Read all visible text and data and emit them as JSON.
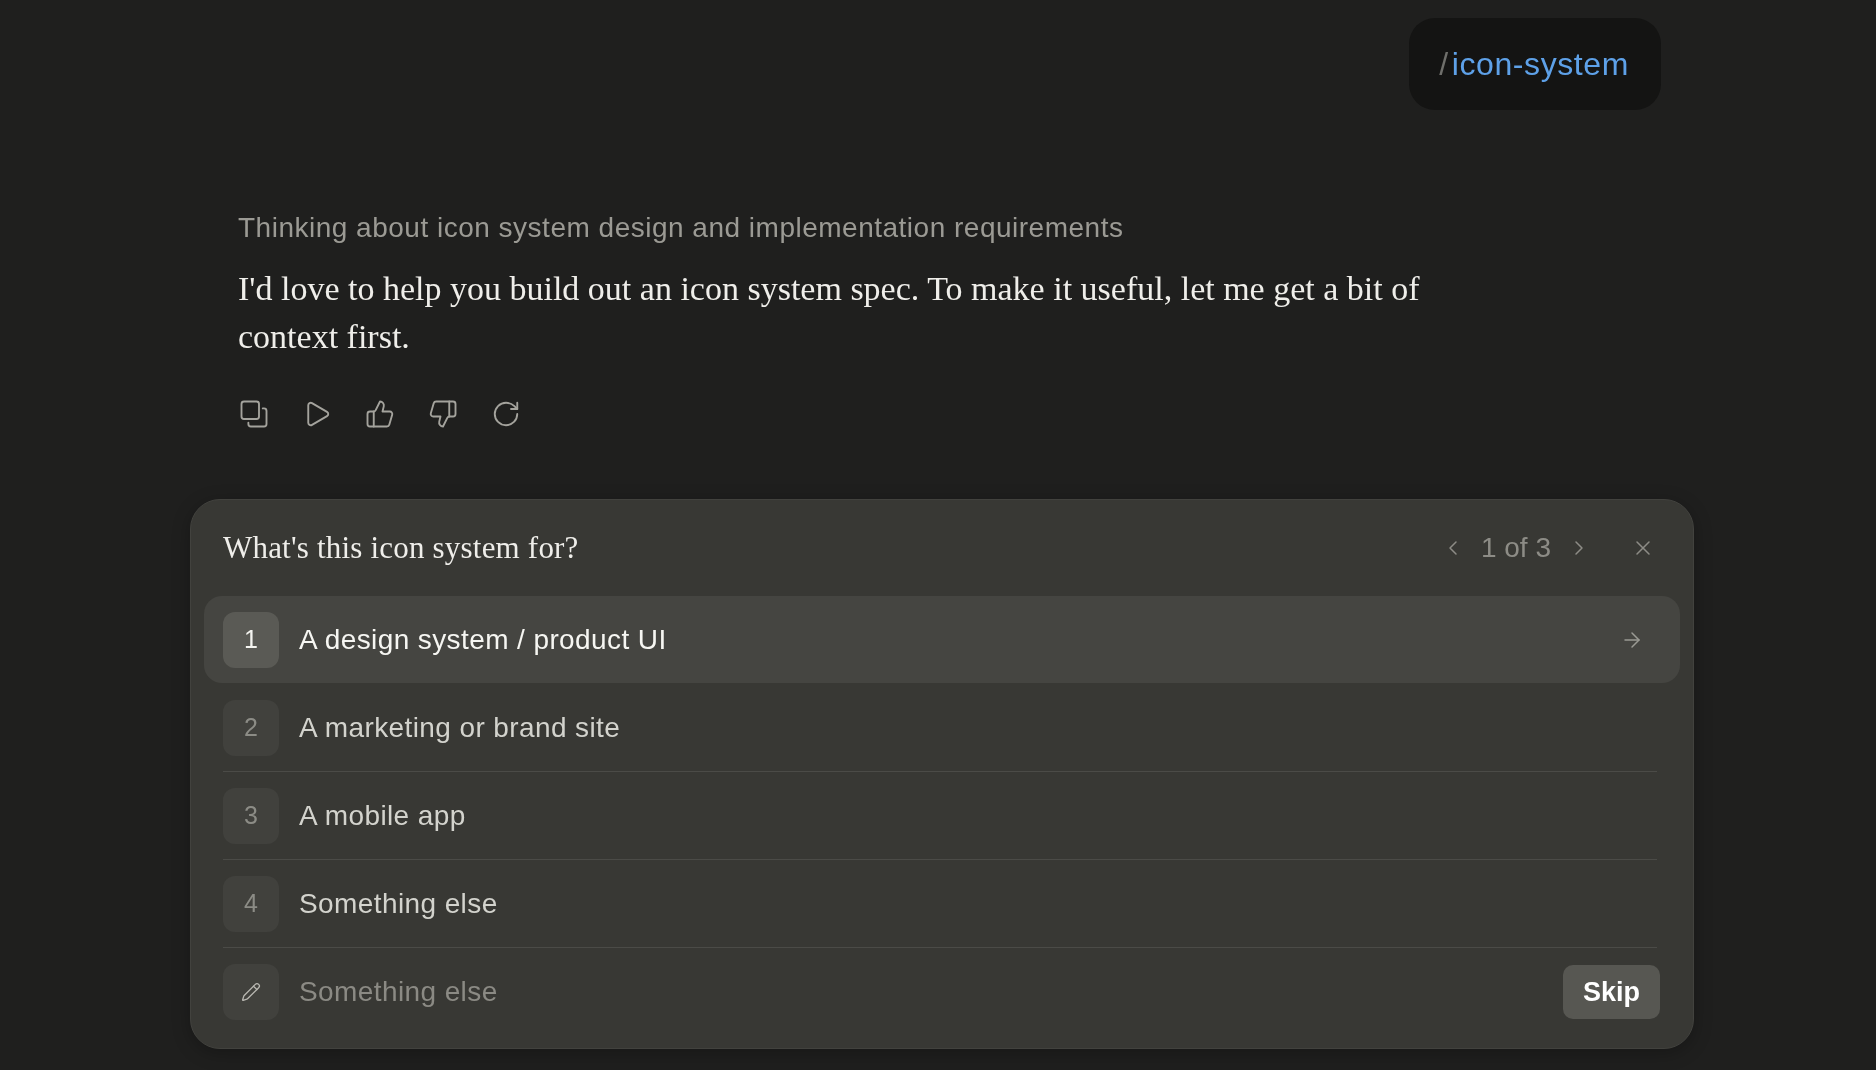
{
  "command_badge": {
    "prefix": "/",
    "command": "icon-system"
  },
  "thinking_summary": "Thinking about icon system design and implementation requirements",
  "message": "I'd love to help you build out an icon system spec. To make it useful, let me get a bit of context first.",
  "question_panel": {
    "question": "What's this icon system for?",
    "pager": "1 of 3",
    "options": [
      {
        "key": "1",
        "label": "A design system / product UI",
        "selected": true
      },
      {
        "key": "2",
        "label": "A marketing or brand site",
        "selected": false
      },
      {
        "key": "3",
        "label": "A mobile app",
        "selected": false
      },
      {
        "key": "4",
        "label": "Something else",
        "selected": false
      }
    ],
    "custom_answer": {
      "placeholder": "Something else"
    },
    "skip_button": "Skip"
  }
}
